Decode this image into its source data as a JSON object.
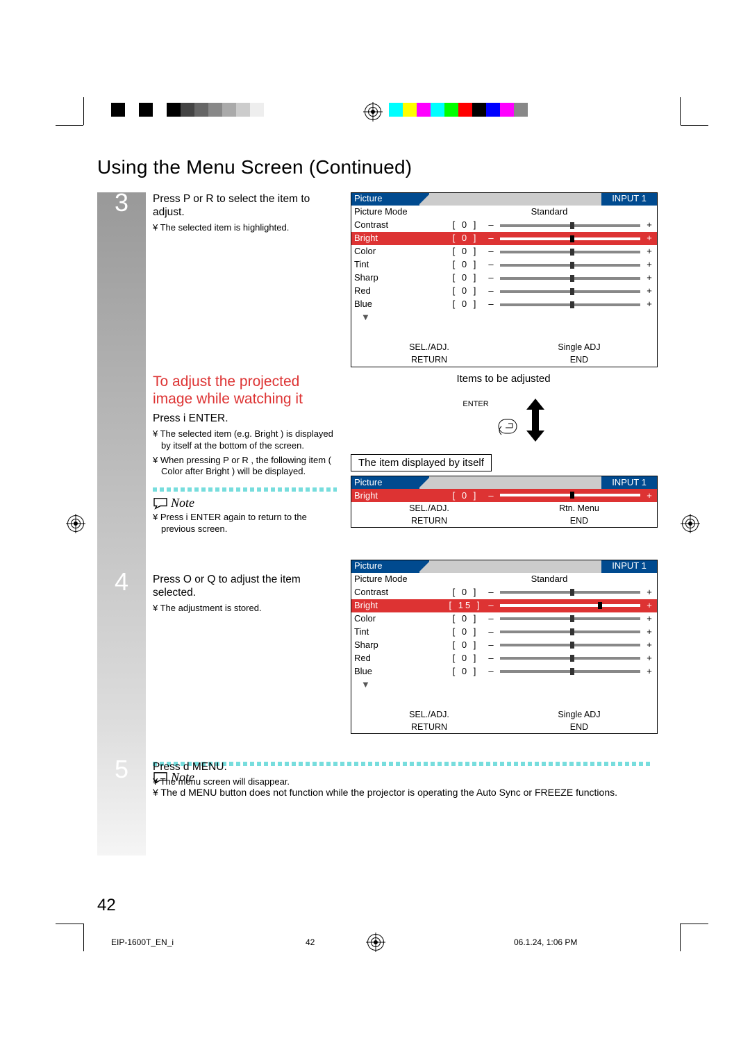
{
  "page_title": "Using the Menu Screen (Continued)",
  "step3": {
    "num": "3",
    "instr": "Press  P  or  R  to select the item to adjust.",
    "bullet": "¥ The selected item is highlighted."
  },
  "osd1": {
    "tab": "Picture",
    "input": "INPUT 1",
    "mode_label": "Picture Mode",
    "mode_value": "Standard",
    "rows": [
      {
        "label": "Contrast",
        "value": "0",
        "selected": false,
        "thumb": 50
      },
      {
        "label": "Bright",
        "value": "0",
        "selected": true,
        "thumb": 50
      },
      {
        "label": "Color",
        "value": "0",
        "selected": false,
        "thumb": 50
      },
      {
        "label": "Tint",
        "value": "0",
        "selected": false,
        "thumb": 50
      },
      {
        "label": "Sharp",
        "value": "0",
        "selected": false,
        "thumb": 50
      },
      {
        "label": "Red",
        "value": "0",
        "selected": false,
        "thumb": 50
      },
      {
        "label": "Blue",
        "value": "0",
        "selected": false,
        "thumb": 50
      }
    ],
    "foot_l1": "SEL./ADJ.",
    "foot_r1": "Single ADJ",
    "foot_l2": "RETURN",
    "foot_r2": "END"
  },
  "caption_items": "Items to be adjusted",
  "enter_label": "ENTER",
  "subheading": "To adjust the projected image while watching it",
  "sub_instr": "Press  i    ENTER.",
  "sub_bullets": [
    "¥ The selected item (e.g.  Bright ) is displayed by itself at the bottom of the screen.",
    "¥ When pressing  P  or  R , the following item (  Color   after   Bright  ) will be displayed."
  ],
  "note1_label": "Note",
  "note1_text": "¥ Press i    ENTER  again to return to the previous screen.",
  "caption_single": "The item displayed by itself",
  "osd2": {
    "tab": "Picture",
    "input": "INPUT 1",
    "row": {
      "label": "Bright",
      "value": "0",
      "thumb": 50
    },
    "foot_l1": "SEL./ADJ.",
    "foot_r1": "Rtn. Menu",
    "foot_l2": "RETURN",
    "foot_r2": "END"
  },
  "step4": {
    "num": "4",
    "instr": "Press  O  or  Q  to adjust the item selected.",
    "bullet": "¥ The adjustment is stored."
  },
  "osd3": {
    "tab": "Picture",
    "input": "INPUT 1",
    "mode_label": "Picture Mode",
    "mode_value": "Standard",
    "rows": [
      {
        "label": "Contrast",
        "value": "0",
        "selected": false,
        "thumb": 50
      },
      {
        "label": "Bright",
        "value": "15",
        "selected": true,
        "thumb": 70
      },
      {
        "label": "Color",
        "value": "0",
        "selected": false,
        "thumb": 50
      },
      {
        "label": "Tint",
        "value": "0",
        "selected": false,
        "thumb": 50
      },
      {
        "label": "Sharp",
        "value": "0",
        "selected": false,
        "thumb": 50
      },
      {
        "label": "Red",
        "value": "0",
        "selected": false,
        "thumb": 50
      },
      {
        "label": "Blue",
        "value": "0",
        "selected": false,
        "thumb": 50
      }
    ],
    "foot_l1": "SEL./ADJ.",
    "foot_r1": "Single ADJ",
    "foot_l2": "RETURN",
    "foot_r2": "END"
  },
  "step5": {
    "num": "5",
    "instr": "Press  d  MENU.",
    "bullet": "¥ The menu screen will disappear."
  },
  "note2_label": "Note",
  "note2_text": "¥ The d   MENU  button does not function while the projector is operating the   Auto Sync   or   FREEZE functions.",
  "page_number": "42",
  "footer": {
    "filename": "EIP-1600T_EN_i",
    "page": "42",
    "datetime": "06.1.24, 1:06 PM"
  },
  "colorbar_left": [
    "#000",
    "#fff",
    "#000",
    "#fff",
    "#000",
    "#444",
    "#666",
    "#888",
    "#aaa",
    "#ccc",
    "#eee",
    "#fff"
  ],
  "colorbar_right": [
    "#0ff",
    "#ff0",
    "#f0f",
    "#0ff",
    "#0f0",
    "#f00",
    "#000",
    "#00f",
    "#f0f",
    "#888",
    "#fff"
  ]
}
